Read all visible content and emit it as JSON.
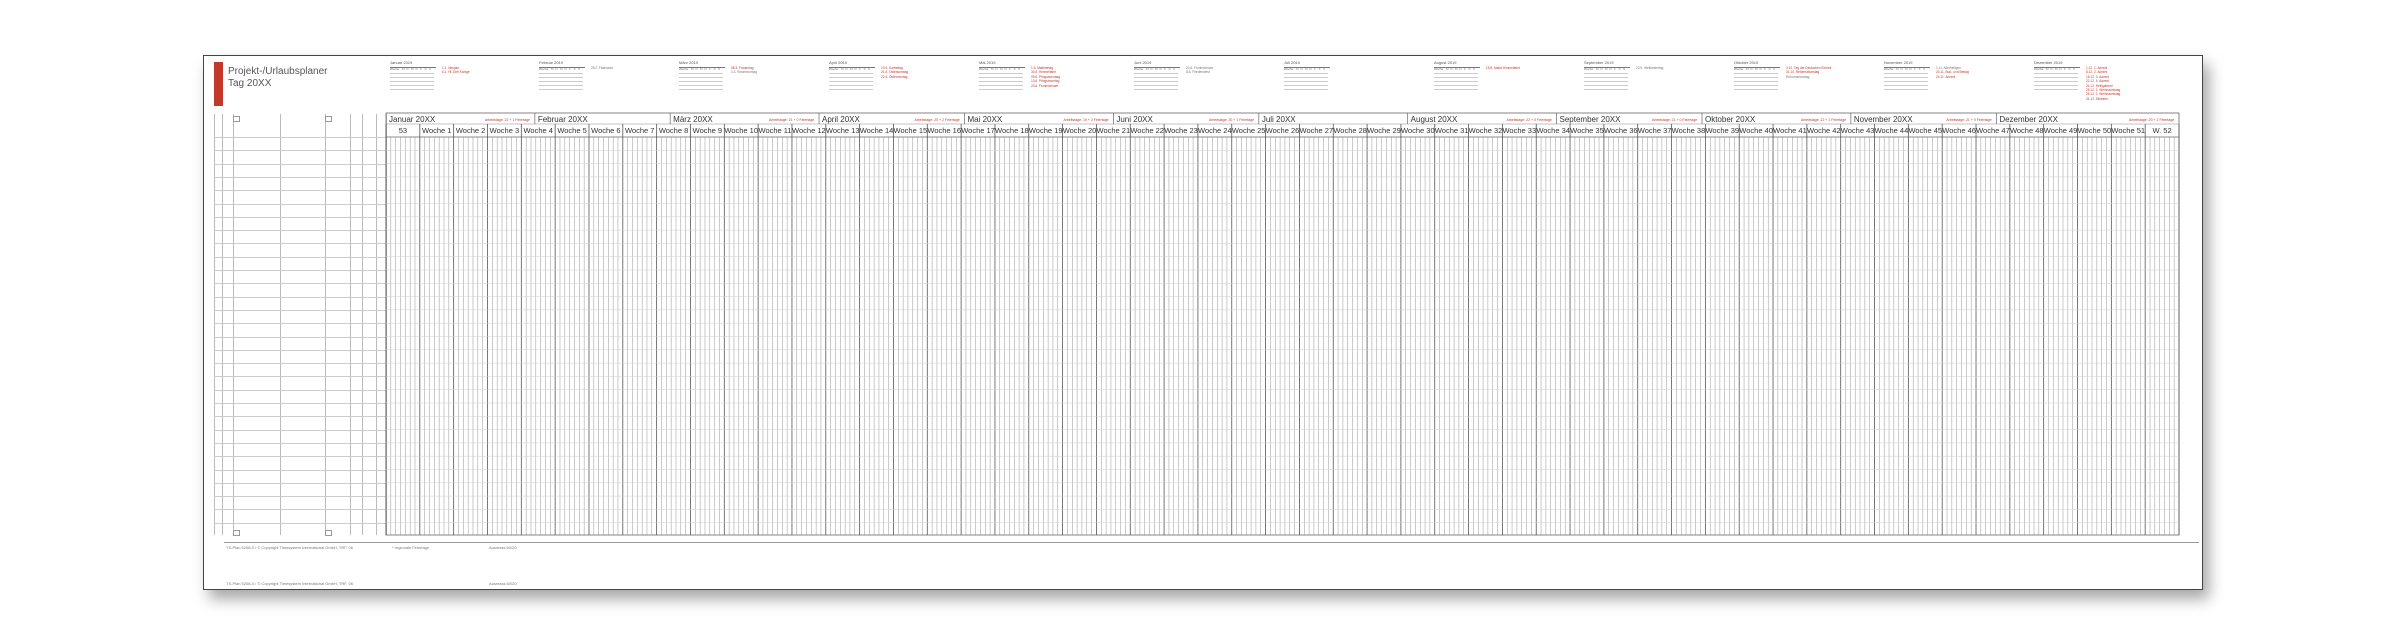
{
  "title": {
    "line1": "Projekt-/Urlaubsplaner",
    "line2": "Tag 20XX"
  },
  "colors": {
    "accent": "#c0392b",
    "grid": "#8a8a8a",
    "grid_light": "#cfcfcf"
  },
  "mini_calendars": [
    {
      "name": "Januar 2019",
      "holidays": [
        [
          "red",
          "1.1. Neujahr"
        ],
        [
          "red",
          "6.1. Hl. Drei Könige"
        ]
      ]
    },
    {
      "name": "Februar 2019",
      "holidays": [
        [
          "grey",
          "28.2. Fastnacht"
        ]
      ]
    },
    {
      "name": "März 2019",
      "holidays": [
        [
          "red",
          "08.3. Frauentag"
        ],
        [
          "grey",
          "4.3. Rosenmontag"
        ]
      ]
    },
    {
      "name": "April 2019",
      "holidays": [
        [
          "red",
          "19.4. Karfreitag"
        ],
        [
          "red",
          "21.4. Ostersonntag"
        ],
        [
          "red",
          "22.4. Ostermontag"
        ]
      ]
    },
    {
      "name": "Mai 2019",
      "holidays": [
        [
          "red",
          "1.5. Maifeiertag"
        ],
        [
          "red",
          "30.5. Himmelfahrt"
        ],
        [
          "red",
          "09.6. Pfingstsonntag"
        ],
        [
          "red",
          "10.6. Pfingstmontag"
        ],
        [
          "red",
          "20.6. Fronleichnam"
        ]
      ]
    },
    {
      "name": "Juni 2019",
      "holidays": [
        [
          "grey",
          "20.6. Fronleichnam"
        ],
        [
          "grey",
          "8.8. Friedensfest"
        ]
      ]
    },
    {
      "name": "Juli 2019",
      "holidays": []
    },
    {
      "name": "August 2019",
      "holidays": [
        [
          "red",
          "15.8. Mariä Himmelfahrt"
        ]
      ]
    },
    {
      "name": "September 2019",
      "holidays": [
        [
          "grey",
          "20.9. Weltkindertag"
        ]
      ]
    },
    {
      "name": "Oktober 2019",
      "holidays": [
        [
          "red",
          "3.10. Tag der Deutschen Einheit"
        ],
        [
          "red",
          "31.10. Reformationstag"
        ],
        [
          "grey",
          "Reformationstag"
        ]
      ]
    },
    {
      "name": "November 2019",
      "holidays": [
        [
          "grey",
          "1.11. Allerheiligen"
        ],
        [
          "red",
          "20.11. Buß- und Bettag"
        ],
        [
          "red",
          "24.11. Advent"
        ]
      ]
    },
    {
      "name": "Dezember 2019",
      "holidays": [
        [
          "red",
          "1.12. 1. Advent"
        ],
        [
          "red",
          "8.12. 2. Advent"
        ],
        [
          "red",
          "15.12. 3. Advent"
        ],
        [
          "red",
          "22.12. 4. Advent"
        ],
        [
          "red",
          "24.12. Heiligabend"
        ],
        [
          "red",
          "25.12. 1. Weihnachtstag"
        ],
        [
          "red",
          "26.12. 2. Weihnachtstag"
        ],
        [
          "red",
          "31.12. Silvester"
        ]
      ]
    }
  ],
  "mini_header": {
    "wk": "Woche",
    "days": [
      "M",
      "D",
      "M",
      "D",
      "F",
      "S",
      "S"
    ]
  },
  "months": [
    {
      "label": "Januar 20XX",
      "note": "Arbeitstage: 22 + 1 Feiertage"
    },
    {
      "label": "Februar 20XX",
      "note": ""
    },
    {
      "label": "März 20XX",
      "note": "Arbeitstage: 21 + 0 Feiertage"
    },
    {
      "label": "April 20XX",
      "note": "Arbeitstage: 20 + 2 Feiertage"
    },
    {
      "label": "Mai 20XX",
      "note": "Arbeitstage: 19 + 3 Feiertage"
    },
    {
      "label": "Juni 20XX",
      "note": "Arbeitstage: 20 + 1 Feiertage"
    },
    {
      "label": "Juli 20XX",
      "note": ""
    },
    {
      "label": "August 20XX",
      "note": "Arbeitstage: 22 + 0 Feiertage"
    },
    {
      "label": "September 20XX",
      "note": "Arbeitstage: 21 + 0 Feiertage"
    },
    {
      "label": "Oktober 20XX",
      "note": "Arbeitstage: 22 + 1 Feiertage"
    },
    {
      "label": "November 20XX",
      "note": "Arbeitstage: 21 + 0 Feiertage"
    },
    {
      "label": "Dezember 20XX",
      "note": "Arbeitstage: 20 + 2 Feiertage"
    }
  ],
  "weeks": [
    "53",
    "Woche 1",
    "Woche 2",
    "Woche 3",
    "Woche 4",
    "Woche 5",
    "Woche 6",
    "Woche 7",
    "Woche 8",
    "Woche 9",
    "Woche 10",
    "Woche 11",
    "Woche 12",
    "Woche 13",
    "Woche 14",
    "Woche 15",
    "Woche 16",
    "Woche 17",
    "Woche 18",
    "Woche 19",
    "Woche 20",
    "Woche 21",
    "Woche 22",
    "Woche 23",
    "Woche 24",
    "Woche 25",
    "Woche 26",
    "Woche 27",
    "Woche 28",
    "Woche 29",
    "Woche 30",
    "Woche 31",
    "Woche 32",
    "Woche 33",
    "Woche 34",
    "Woche 35",
    "Woche 36",
    "Woche 37",
    "Woche 38",
    "Woche 39",
    "Woche 40",
    "Woche 41",
    "Woche 42",
    "Woche 43",
    "Woche 44",
    "Woche 45",
    "Woche 46",
    "Woche 47",
    "Woche 48",
    "Woche 49",
    "Woche 50",
    "Woche 51",
    "W. 52"
  ],
  "footer": {
    "copyright_1": "TS-Plan 5208-0 / © Copyright Timesystem International GmbH, TRF, 06",
    "legend": "* regionale Feiertage",
    "status_1": "Ausmass 60/20",
    "copyright_2": "TS-Plan 5208-0 / © Copyright Timesystem International GmbH, TRF, 06",
    "status_2": "Ausmass 60/20"
  }
}
